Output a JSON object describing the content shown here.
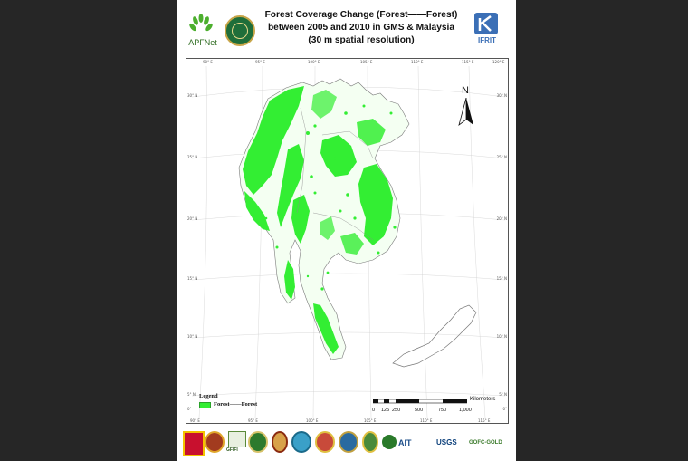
{
  "header": {
    "title_line1": "Forest Coverage Change (Forest——Forest)",
    "title_line2": "between 2005 and 2010 in GMS & Malaysia",
    "title_line3": "(30 m spatial resolution)",
    "logo_left_text": "APFNet",
    "logo_right_text": "IFRIT"
  },
  "map": {
    "north_label": "N",
    "top_ticks": [
      "90° E",
      "95° E",
      "100° E",
      "105° E",
      "110° E",
      "115° E",
      "120° E"
    ],
    "bottom_ticks": [
      "90° E",
      "95° E",
      "100° E",
      "105° E",
      "110° E",
      "115° E"
    ],
    "left_ticks": [
      "30° N",
      "25° N",
      "20° N",
      "15° N",
      "10° N",
      "5° N",
      "0°"
    ],
    "right_ticks": [
      "30° N",
      "25° N",
      "20° N",
      "15° N",
      "10° N",
      "5° N",
      "0°"
    ],
    "forest_color": "#33ee33"
  },
  "legend": {
    "title": "Legend",
    "item_label": "Forest——Forest",
    "item_color": "#33ee33"
  },
  "scalebar": {
    "unit": "Kilometers",
    "labels": [
      "0",
      "125",
      "250",
      "500",
      "750",
      "1,000"
    ]
  },
  "footer": {
    "logos": [
      "umd-icon",
      "seal-icon",
      "gfifi-icon",
      "leaf-seal-icon",
      "tree-seal-icon",
      "globe-icon",
      "myanmar-seal-icon",
      "vietnam-seal-icon",
      "thai-seal-icon",
      "ait-icon",
      "usgs-icon",
      "gofc-gold-icon"
    ],
    "gfifi_text": "GFIFI",
    "ait_text": "AIT",
    "usgs_text": "USGS",
    "gofc_text": "GOFC-GOLD"
  }
}
